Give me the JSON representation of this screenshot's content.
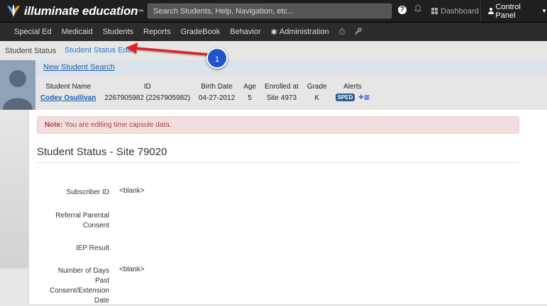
{
  "app": {
    "brand": "illuminate education",
    "trademark": "™",
    "search_placeholder": "Search Students, Help, Navigation, etc...",
    "dashboard_label": "Dashboard",
    "control_panel_label": "Control Panel"
  },
  "nav": {
    "items": [
      "Special Ed",
      "Medicaid",
      "Students",
      "Reports",
      "GradeBook",
      "Behavior",
      "Administration"
    ]
  },
  "breadcrumb": {
    "current": "Student Status",
    "edit_link": "Student Status Edit"
  },
  "callout": {
    "number": "1",
    "color": "#e02020"
  },
  "student": {
    "new_search": "New Student Search",
    "headers": [
      "Student Name",
      "ID",
      "Birth Date",
      "Age",
      "Enrolled at",
      "Grade",
      "Alerts"
    ],
    "name": "Codey Osullivan",
    "id": "2267905982 (2267905982)",
    "birth_date": "04-27-2012",
    "age": "5",
    "enrolled_at": "Site 4973",
    "grade": "K",
    "alert_badge": "SPED"
  },
  "notice": {
    "prefix": "Note:",
    "text": " You are editing time capsule data."
  },
  "page_title": "Student Status - Site 79020",
  "fields": [
    {
      "label": "Subscriber ID",
      "value": "<blank>"
    },
    {
      "label": "Referral Parental Consent",
      "value": ""
    },
    {
      "label": "IEP Result",
      "value": ""
    },
    {
      "label": "Number of Days Past Consent/Extension Date",
      "value": "<blank>"
    }
  ],
  "colors": {
    "topbar": "#1f1f1f",
    "navbar": "#2c2c2c",
    "link": "#2b7bd1",
    "notice_bg": "#f2dede",
    "notice_text": "#a94442",
    "badge": "#1f55c8"
  }
}
